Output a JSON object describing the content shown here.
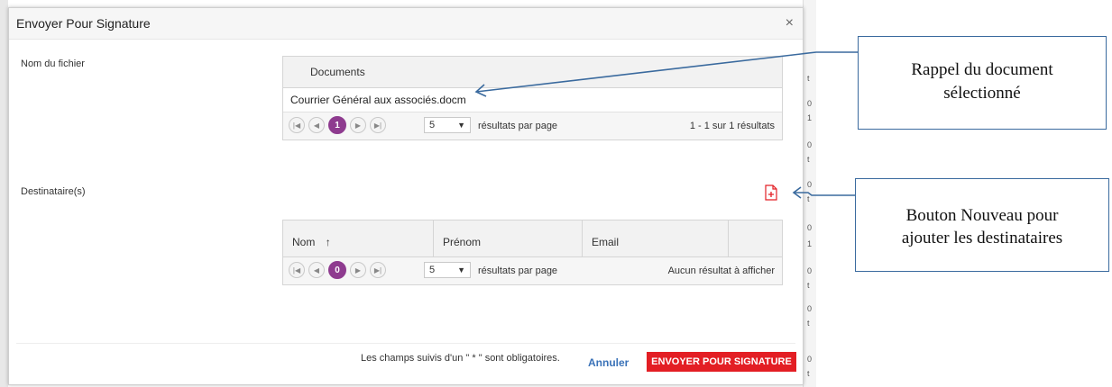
{
  "dialog": {
    "title": "Envoyer Pour Signature",
    "close_label": "×"
  },
  "file_section": {
    "label": "Nom du fichier",
    "column_header": "Documents",
    "rows": [
      "Courrier Général aux associés.docm"
    ],
    "pager": {
      "first": "|◀",
      "prev": "◀",
      "current": "1",
      "next": "▶",
      "last": "▶|",
      "page_size": "5",
      "per_page_label": "résultats par page",
      "info": "1 - 1 sur 1 résultats"
    }
  },
  "recipients_section": {
    "label": "Destinataire(s)",
    "add_icon": "document-add-icon",
    "columns": [
      "Nom",
      "Prénom",
      "Email"
    ],
    "sort_indicator": "↑",
    "pager": {
      "first": "|◀",
      "prev": "◀",
      "current": "0",
      "next": "▶",
      "last": "▶|",
      "page_size": "5",
      "per_page_label": "résultats par page",
      "info": "Aucun résultat à afficher"
    }
  },
  "footer": {
    "required_note": "Les champs suivis d'un \" * \" sont obligatoires.",
    "cancel_label": "Annuler",
    "submit_label": "ENVOYER POUR SIGNATURE"
  },
  "annotations": [
    {
      "text_line1": "Rappel du document",
      "text_line2": "sélectionné"
    },
    {
      "text_line1": "Bouton Nouveau pour",
      "text_line2": "ajouter les destinataires"
    }
  ],
  "background_fragments": [
    "t",
    "0",
    "1",
    "0",
    "t",
    "0",
    "t",
    "0",
    "1",
    "0",
    "t",
    "0",
    "t",
    "0",
    "t"
  ],
  "colors": {
    "accent_purple": "#8e3b8f",
    "submit_red": "#e31e24",
    "link_blue": "#3a72b8",
    "arrow_blue": "#3a6a9e"
  }
}
